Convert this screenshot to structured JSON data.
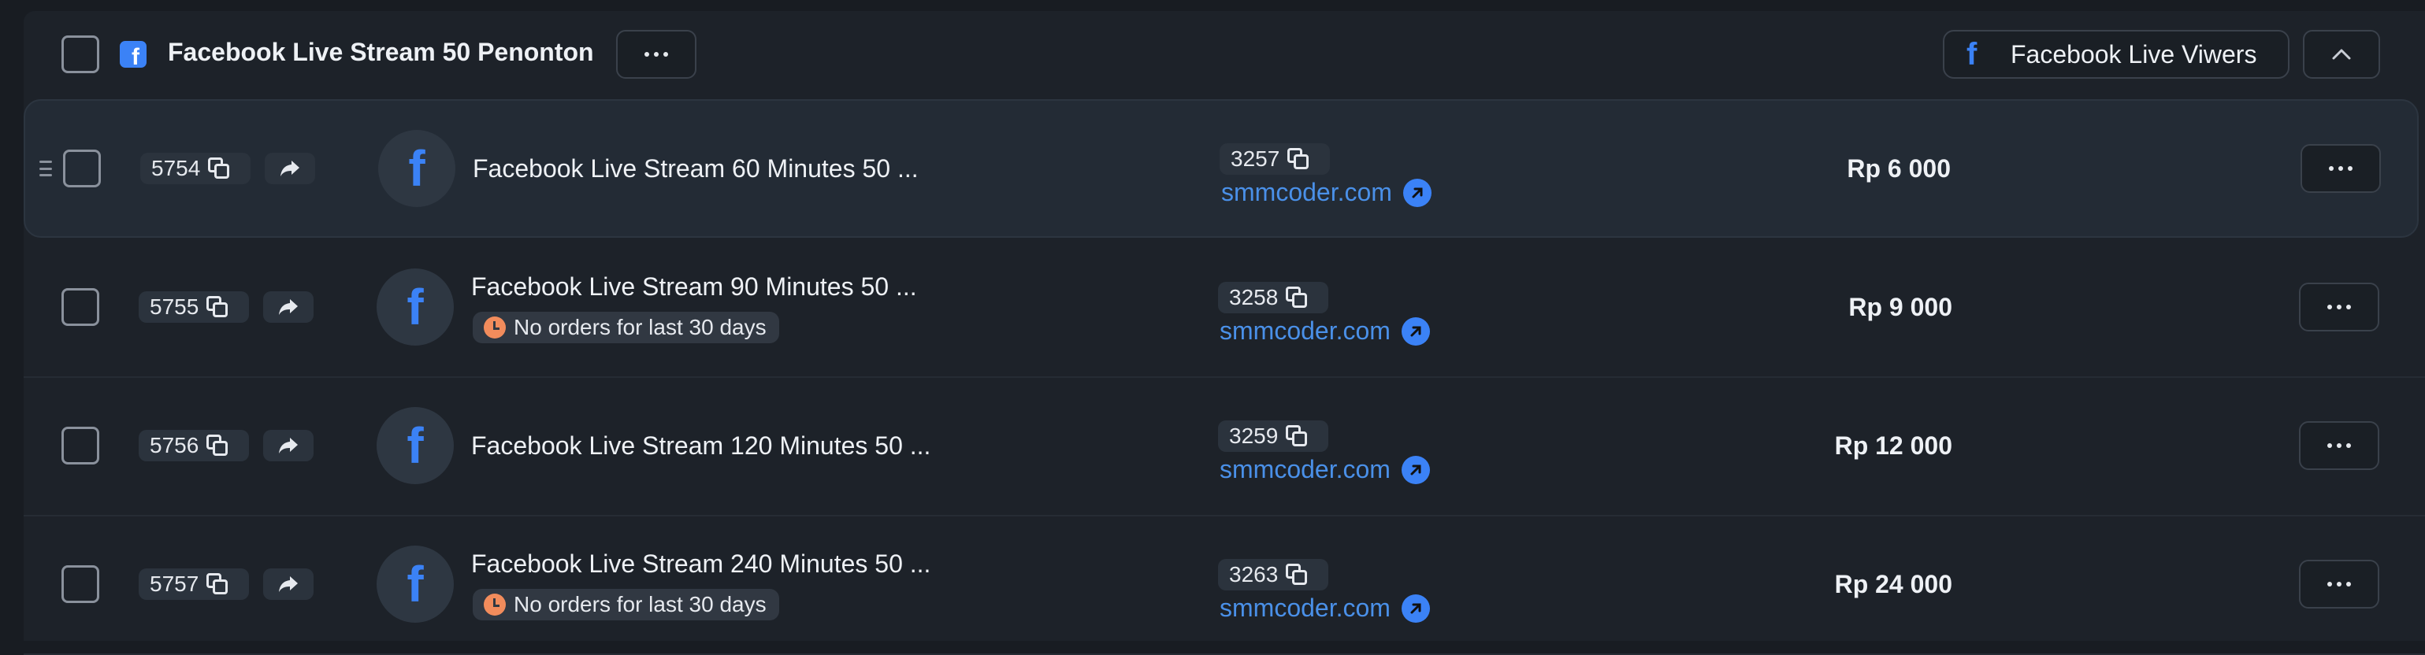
{
  "header": {
    "group_title": "Facebook Live Stream 50 Penonton",
    "category_label": "Facebook Live Viwers",
    "fb_glyph": "f"
  },
  "icons": {
    "facebook": "facebook-icon",
    "copy": "copy-icon",
    "share": "share-icon",
    "more": "more-icon",
    "chevron": "chevron-up-icon",
    "clock": "clock-icon",
    "external": "external-link-icon"
  },
  "colors": {
    "accent": "#3b82f6",
    "link": "#4a90e8",
    "warning": "#f28c5c",
    "background": "#181c22"
  },
  "rows": [
    {
      "id": "5754",
      "name": "Facebook Live Stream 60 Minutes 50 ...",
      "warning": "",
      "provider_id": "3257",
      "provider": "smmcoder.com",
      "price": "Rp 6 000",
      "selected": true
    },
    {
      "id": "5755",
      "name": "Facebook Live Stream 90 Minutes 50 ...",
      "warning": "No orders for last 30 days",
      "provider_id": "3258",
      "provider": "smmcoder.com",
      "price": "Rp 9 000",
      "selected": false
    },
    {
      "id": "5756",
      "name": "Facebook Live Stream 120 Minutes 50 ...",
      "warning": "",
      "provider_id": "3259",
      "provider": "smmcoder.com",
      "price": "Rp 12 000",
      "selected": false
    },
    {
      "id": "5757",
      "name": "Facebook Live Stream 240 Minutes 50 ...",
      "warning": "No orders for last 30 days",
      "provider_id": "3263",
      "provider": "smmcoder.com",
      "price": "Rp 24 000",
      "selected": false
    }
  ]
}
